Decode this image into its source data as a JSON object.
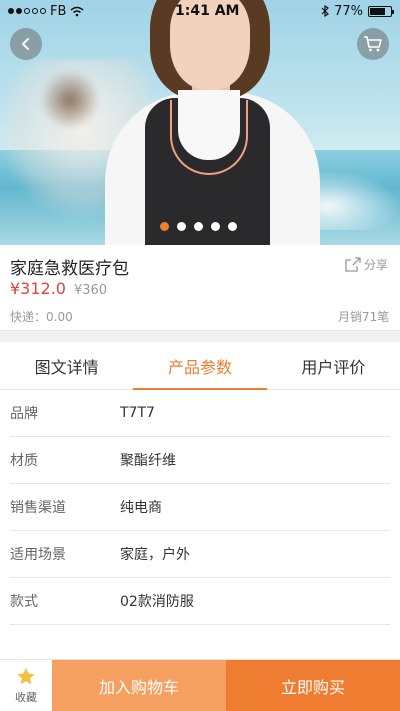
{
  "status_bar": {
    "carrier": "FB",
    "time": "1:41 AM",
    "battery": "77%",
    "battery_level": 0.77
  },
  "hero": {
    "back_icon": "back-arrow-icon",
    "cart_icon": "cart-icon",
    "carousel_total": 5,
    "carousel_active": 1
  },
  "product": {
    "title": "家庭急救医疗包",
    "share_label": "分享",
    "price": "¥312.0",
    "original_price": "¥360",
    "shipping": "快递：0.00",
    "sales": "月销71笔"
  },
  "tabs": [
    {
      "label": "图文详情",
      "active": false
    },
    {
      "label": "产品参数",
      "active": true
    },
    {
      "label": "用户评价",
      "active": false
    }
  ],
  "specs": [
    {
      "key": "品牌",
      "value": "T7T7"
    },
    {
      "key": "材质",
      "value": "聚酯纤维"
    },
    {
      "key": "销售渠道",
      "value": "纯电商"
    },
    {
      "key": "适用场景",
      "value": "家庭，户外"
    },
    {
      "key": "款式",
      "value": "02款消防服"
    }
  ],
  "bottom_bar": {
    "favorite_label": "收藏",
    "add_to_cart_label": "加入购物车",
    "buy_now_label": "立即购买"
  },
  "colors": {
    "accent": "#ef7d31",
    "accent_light": "#f59f61",
    "price": "#e0433e",
    "star": "#f2c03a"
  }
}
